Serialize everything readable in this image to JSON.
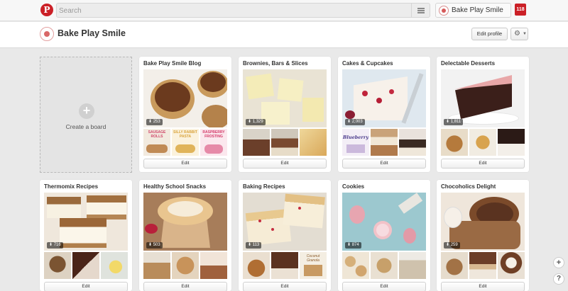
{
  "topbar": {
    "logo_letter": "P",
    "search_placeholder": "Search",
    "user_name": "Bake Play Smile",
    "notification_count": "118"
  },
  "profile": {
    "name": "Bake Play Smile",
    "edit_profile_label": "Edit profile"
  },
  "create_board": {
    "label": "Create a board"
  },
  "edit_label": "Edit",
  "boards": [
    {
      "title": "Bake Play Smile Blog",
      "pins": "253"
    },
    {
      "title": "Brownies, Bars & Slices",
      "pins": "1,329"
    },
    {
      "title": "Cakes & Cupcakes",
      "pins": "2,003"
    },
    {
      "title": "Delectable Desserts",
      "pins": "1,811"
    },
    {
      "title": "Thermomix Recipes",
      "pins": "716"
    },
    {
      "title": "Healthy School Snacks",
      "pins": "503"
    },
    {
      "title": "Baking Recipes",
      "pins": "113"
    },
    {
      "title": "Cookies",
      "pins": "874"
    },
    {
      "title": "Chocoholics Delight",
      "pins": "259"
    }
  ],
  "thumb_text": {
    "b1_t1": "SAUSAGE ROLLS",
    "b1_t2": "SILLY RABBIT PASTA",
    "b1_t3": "RASPBERRY FROSTING",
    "b3_t1": "Blueberry",
    "b7_t3": "Coconut Granola"
  }
}
